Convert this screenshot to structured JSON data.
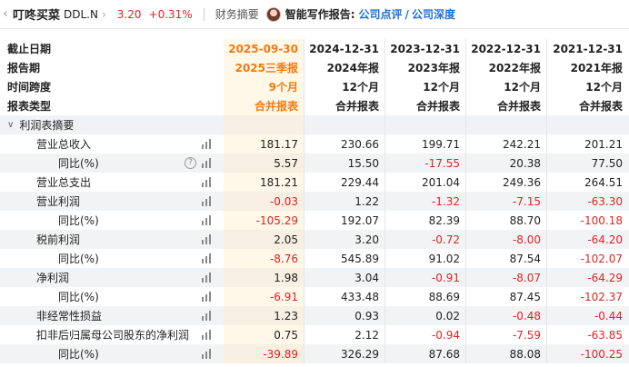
{
  "topbar": {
    "back_icon": "chevron-left-icon",
    "name": "叮咚买菜",
    "code": "DDL.N",
    "chevron": "›",
    "price": "3.20",
    "change": "+0.31%",
    "crumb": "财务摘要",
    "ai_label": "智能写作报告:",
    "link1": "公司点评",
    "sep": "/",
    "link2": "公司深度",
    "colors": {
      "up": "#e02424",
      "link": "#1e6fd9",
      "highlight": "#f37a10"
    }
  },
  "header_rows": [
    {
      "label": "截止日期",
      "values": [
        "2025-09-30",
        "2024-12-31",
        "2023-12-31",
        "2022-12-31",
        "2021-12-31"
      ]
    },
    {
      "label": "报告期",
      "values": [
        "2025三季报",
        "2024年报",
        "2023年报",
        "2022年报",
        "2021年报"
      ]
    },
    {
      "label": "时间跨度",
      "values": [
        "9个月",
        "12个月",
        "12个月",
        "12个月",
        "12个月"
      ]
    },
    {
      "label": "报表类型",
      "values": [
        "合并报表",
        "合并报表",
        "合并报表",
        "合并报表",
        "合并报表"
      ]
    }
  ],
  "section": {
    "label": "利润表摘要",
    "toggle": "∨"
  },
  "rows": [
    {
      "label": "营业总收入",
      "level": 1,
      "help": false,
      "values": [
        "181.17",
        "230.66",
        "199.71",
        "242.21",
        "201.21"
      ]
    },
    {
      "label": "同比(%)",
      "level": 2,
      "help": true,
      "values": [
        "5.57",
        "15.50",
        "-17.55",
        "20.38",
        "77.50"
      ]
    },
    {
      "label": "营业总支出",
      "level": 1,
      "help": false,
      "values": [
        "181.21",
        "229.44",
        "201.04",
        "249.36",
        "264.51"
      ]
    },
    {
      "label": "营业利润",
      "level": 1,
      "help": false,
      "values": [
        "-0.03",
        "1.22",
        "-1.32",
        "-7.15",
        "-63.30"
      ]
    },
    {
      "label": "同比(%)",
      "level": 2,
      "help": false,
      "values": [
        "-105.29",
        "192.07",
        "82.39",
        "88.70",
        "-100.18"
      ]
    },
    {
      "label": "税前利润",
      "level": 1,
      "help": false,
      "values": [
        "2.05",
        "3.20",
        "-0.72",
        "-8.00",
        "-64.20"
      ]
    },
    {
      "label": "同比(%)",
      "level": 2,
      "help": false,
      "values": [
        "-8.76",
        "545.89",
        "91.02",
        "87.54",
        "-102.07"
      ]
    },
    {
      "label": "净利润",
      "level": 1,
      "help": false,
      "values": [
        "1.98",
        "3.04",
        "-0.91",
        "-8.07",
        "-64.29"
      ]
    },
    {
      "label": "同比(%)",
      "level": 2,
      "help": false,
      "values": [
        "-6.91",
        "433.48",
        "88.69",
        "87.45",
        "-102.37"
      ]
    },
    {
      "label": "非经常性损益",
      "level": 1,
      "help": false,
      "values": [
        "1.23",
        "0.93",
        "0.02",
        "-0.48",
        "-0.44"
      ]
    },
    {
      "label": "扣非后归属母公司股东的净利润",
      "level": 1,
      "help": false,
      "values": [
        "0.75",
        "2.12",
        "-0.94",
        "-7.59",
        "-63.85"
      ]
    },
    {
      "label": "同比(%)",
      "level": 2,
      "help": false,
      "values": [
        "-39.89",
        "326.29",
        "87.68",
        "88.08",
        "-100.25"
      ]
    }
  ]
}
